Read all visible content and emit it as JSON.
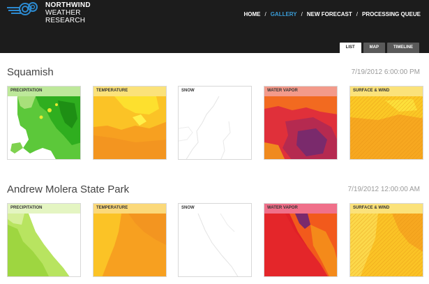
{
  "header": {
    "brand_line1": "NORTHWIND",
    "brand_line2": "WEATHER RESEARCH",
    "nav": [
      {
        "label": "HOME",
        "active": false
      },
      {
        "label": "GALLERY",
        "active": true
      },
      {
        "label": "NEW FORECAST",
        "active": false
      },
      {
        "label": "PROCESSING QUEUE",
        "active": false
      }
    ],
    "nav_separator": "/",
    "accent_color": "#3a9bd5"
  },
  "view_tabs": [
    {
      "label": "LIST",
      "active": true
    },
    {
      "label": "MAP",
      "active": false
    },
    {
      "label": "TIMELINE",
      "active": false
    }
  ],
  "forecasts": [
    {
      "name": "Squamish",
      "datetime": "7/19/2012 6:00:00 PM",
      "tiles": [
        {
          "label": "PRECIPITATION",
          "icon": "precipitation-map"
        },
        {
          "label": "TEMPERATURE",
          "icon": "temperature-map"
        },
        {
          "label": "SNOW",
          "icon": "snow-map"
        },
        {
          "label": "WATER VAPOR",
          "icon": "water-vapor-map"
        },
        {
          "label": "SURFACE & WIND",
          "icon": "surface-wind-map"
        }
      ]
    },
    {
      "name": "Andrew Molera State Park",
      "datetime": "7/19/2012 12:00:00 AM",
      "tiles": [
        {
          "label": "PRECIPITATION",
          "icon": "precipitation-map"
        },
        {
          "label": "TEMPERATURE",
          "icon": "temperature-map"
        },
        {
          "label": "SNOW",
          "icon": "snow-map"
        },
        {
          "label": "WATER VAPOR",
          "icon": "water-vapor-map"
        },
        {
          "label": "SURFACE & WIND",
          "icon": "surface-wind-map"
        }
      ]
    }
  ]
}
